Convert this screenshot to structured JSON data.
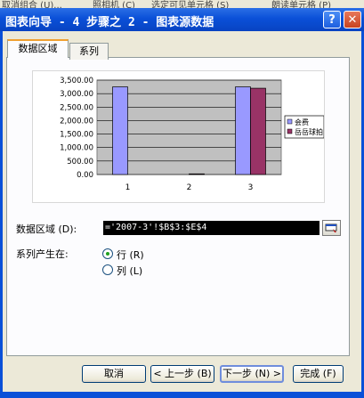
{
  "background_text": [
    "取消组合 (U)...",
    "照相机 (C)",
    "选定可见单元格 (S)",
    "朗读单元格 (P)"
  ],
  "window": {
    "title": "图表向导 - 4 步骤之 2 - 图表源数据",
    "help": "?",
    "close": "✕"
  },
  "tabs": [
    {
      "label": "数据区域"
    },
    {
      "label": "系列"
    }
  ],
  "chart_data": {
    "type": "bar",
    "categories": [
      "1",
      "2",
      "3"
    ],
    "series": [
      {
        "name": "会费",
        "values": [
          3250,
          0,
          3250
        ],
        "color": "#9999ff"
      },
      {
        "name": "岳岳球拍",
        "values": [
          0,
          25,
          3200
        ],
        "color": "#993366"
      }
    ],
    "ylim": [
      0,
      3500
    ],
    "yticks": [
      "3,500.00",
      "3,000.00",
      "2,500.00",
      "2,000.00",
      "1,500.00",
      "1,000.00",
      "500.00",
      "0.00"
    ],
    "plot_background": "#c0c0c0",
    "grid": true,
    "legend_position": "right"
  },
  "form": {
    "range_label": "数据区域 (D):",
    "range_value": "='2007-3'!$B$3:$E$4",
    "series_in_label": "系列产生在:",
    "rows_label": "行 (R)",
    "cols_label": "列 (L)"
  },
  "buttons": {
    "cancel": "取消",
    "back": "< 上一步 (B)",
    "next": "下一步 (N) >",
    "finish": "完成 (F)"
  }
}
